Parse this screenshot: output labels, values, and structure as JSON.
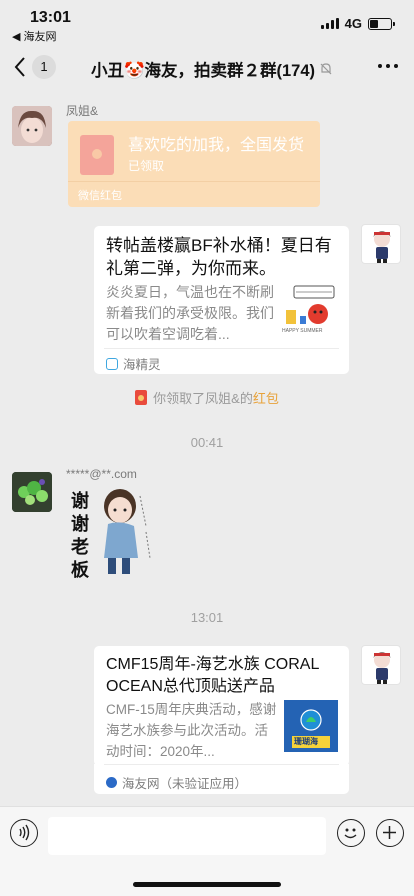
{
  "status_bar": {
    "time": "13:01",
    "back_app": "海友网",
    "network": "4G"
  },
  "nav": {
    "unread_count": "1",
    "title": "小丑🤡海友，拍卖群２群(174)"
  },
  "messages": {
    "red_packet": {
      "sender": "凤姐&",
      "text": "喜欢吃的加我，全国发货",
      "status": "已领取",
      "footer": "微信红包"
    },
    "card1": {
      "title": "转帖盖楼赢BF补水桶！夏日有礼第二弹，为你而来。",
      "desc": "炎炎夏日，气温也在不断刷新着我们的承受极限。我们可以吹着空调吃着...",
      "source": "海精灵",
      "thumb_caption": "HAPPY SUMMER"
    },
    "notice": {
      "prefix": "你领取了凤姐&的",
      "highlight": "红包"
    },
    "time1": "00:41",
    "sticker": {
      "sender": "*****@**.com",
      "text": "谢\n谢\n老\n板"
    },
    "time2": "13:01",
    "card2": {
      "title": "CMF15周年-海艺水族 CORAL OCEAN总代顶贴送产品",
      "desc": "CMF-15周年庆典活动，感谢海艺水族参与此次活动。活动时间：2020年...",
      "source": "海友网（未验证应用）",
      "thumb_caption": "珊瑚海"
    }
  },
  "colors": {
    "background": "#ececec",
    "red_packet_received": "#fbddb7",
    "highlight": "#e8a23a"
  }
}
